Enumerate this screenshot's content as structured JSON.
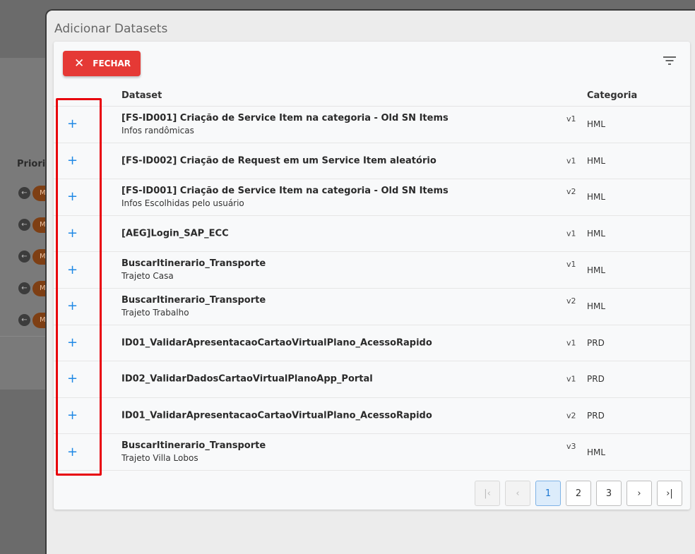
{
  "background": {
    "label": "Priorid",
    "badge": "M"
  },
  "modal": {
    "title": "Adicionar Datasets",
    "close_label": "FECHAR",
    "columns": {
      "dataset": "Dataset",
      "categoria": "Categoria"
    },
    "rows": [
      {
        "name": "[FS-ID001] Criação de Service Item na categoria - Old SN Items",
        "desc": "Infos randômicas",
        "version": "v1",
        "category": "HML"
      },
      {
        "name": "[FS-ID002] Criação de Request em um Service Item aleatório",
        "desc": "",
        "version": "v1",
        "category": "HML"
      },
      {
        "name": "[FS-ID001] Criação de Service Item na categoria - Old SN Items",
        "desc": "Infos Escolhidas pelo usuário",
        "version": "v2",
        "category": "HML"
      },
      {
        "name": "[AEG]Login_SAP_ECC",
        "desc": "",
        "version": "v1",
        "category": "HML"
      },
      {
        "name": "BuscarItinerario_Transporte",
        "desc": "Trajeto Casa",
        "version": "v1",
        "category": "HML"
      },
      {
        "name": "BuscarItinerario_Transporte",
        "desc": "Trajeto Trabalho",
        "version": "v2",
        "category": "HML"
      },
      {
        "name": "ID01_ValidarApresentacaoCartaoVirtualPlano_AcessoRapido",
        "desc": "",
        "version": "v1",
        "category": "PRD"
      },
      {
        "name": "ID02_ValidarDadosCartaoVirtualPlanoApp_Portal",
        "desc": "",
        "version": "v1",
        "category": "PRD"
      },
      {
        "name": "ID01_ValidarApresentacaoCartaoVirtualPlano_AcessoRapido",
        "desc": "",
        "version": "v2",
        "category": "PRD"
      },
      {
        "name": "BuscarItinerario_Transporte",
        "desc": "Trajeto Villa Lobos",
        "version": "v3",
        "category": "HML"
      }
    ],
    "pagination": {
      "first": "|‹",
      "prev": "‹",
      "pages": [
        "1",
        "2",
        "3"
      ],
      "active_page": "1",
      "next": "›",
      "last": "›|"
    }
  },
  "colors": {
    "accent": "#1e88e5",
    "close_button": "#e53935",
    "highlight": "#e8000b"
  }
}
